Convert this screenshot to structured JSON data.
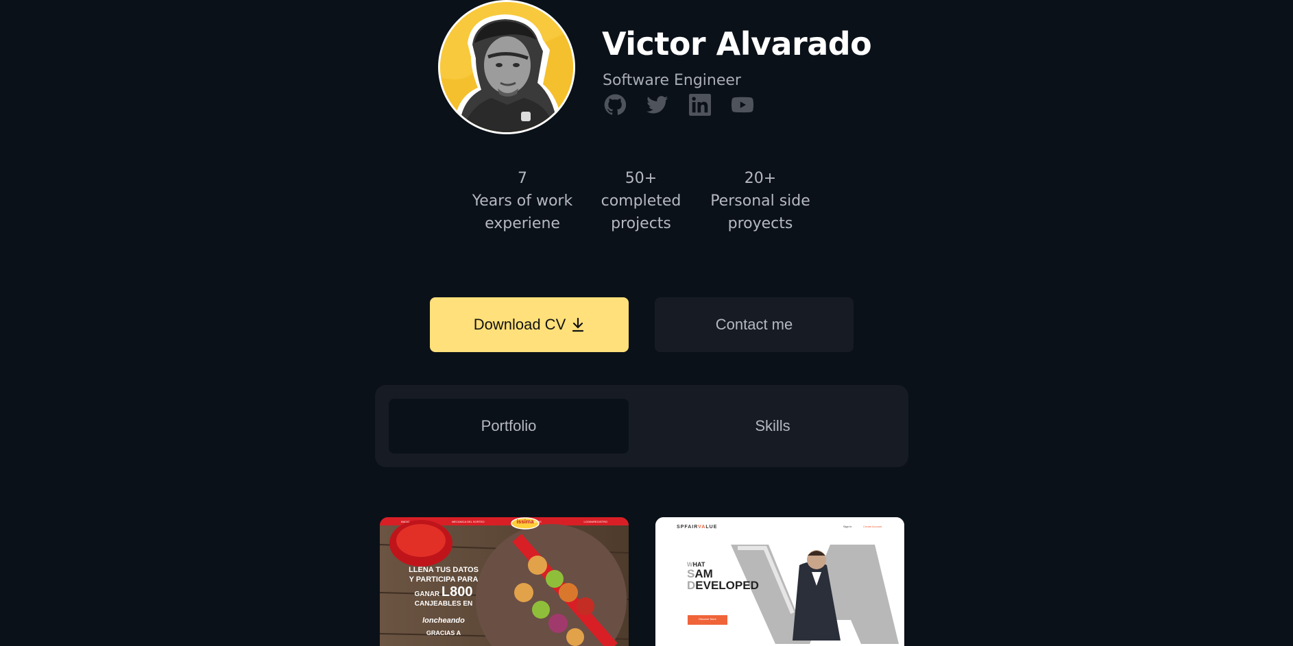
{
  "profile": {
    "name": "Victor Alvarado",
    "role": "Software Engineer",
    "socials": [
      "github-icon",
      "twitter-icon",
      "linkedin-icon",
      "youtube-icon"
    ]
  },
  "stats": [
    {
      "value": "7",
      "label_line1": "Years of work",
      "label_line2": "experiene"
    },
    {
      "value": "50+",
      "label_line1": "completed",
      "label_line2": "projects"
    },
    {
      "value": "20+",
      "label_line1": "Personal side",
      "label_line2": "proyects"
    }
  ],
  "actions": {
    "download_label": "Download CV",
    "contact_label": "Contact me"
  },
  "tabs": {
    "portfolio_label": "Portfolio",
    "skills_label": "Skills"
  },
  "projects": [
    {
      "nav": [
        "INICIO",
        "MECANICA DEL SORTEO",
        "TERMINOS",
        "LOGIN/REGISTRO"
      ],
      "brand": "issima",
      "headline_lines": [
        "LLENA TUS DATOS",
        "Y PARTICIPA PARA"
      ],
      "prize_prefix": "GANAR",
      "prize": "L800",
      "prize_suffix": "CANJEABLES EN",
      "partner": "loncheando",
      "thanks": "GRACIAS A"
    },
    {
      "logo_part1": "SPFAIR",
      "logo_part2": "VA",
      "logo_part3": "LUE",
      "nav_signin": "Sign In",
      "nav_cta": "Create Account",
      "headline_l1_a": "W",
      "headline_l1_b": "HAT",
      "headline_l2_a": "S",
      "headline_l2_b": "AM",
      "headline_l3_a": "D",
      "headline_l3_b": "EVELOPED",
      "big_letters": "VA",
      "cta": "Discover More"
    }
  ],
  "colors": {
    "background": "#0b1119",
    "accent_yellow": "#ffe07a",
    "panel": "#171c24",
    "muted_text": "#b6b9c1"
  }
}
